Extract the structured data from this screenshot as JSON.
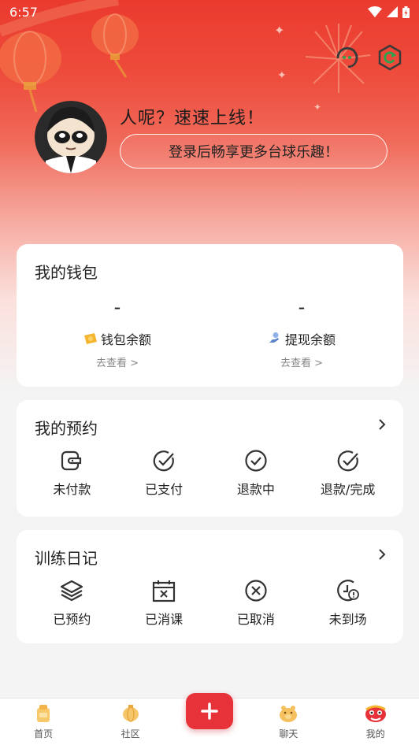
{
  "status_bar": {
    "time": "6:57"
  },
  "profile": {
    "greeting": "人呢？速速上线！",
    "login_button": "登录后畅享更多台球乐趣！"
  },
  "wallet": {
    "title": "我的钱包",
    "balance": {
      "value": "-",
      "label": "钱包余额",
      "link": "去查看 >"
    },
    "withdraw": {
      "value": "-",
      "label": "提现余额",
      "link": "去查看 >"
    }
  },
  "orders": {
    "title": "我的预约",
    "items": [
      {
        "label": "未付款",
        "icon": "wallet-icon"
      },
      {
        "label": "已支付",
        "icon": "check-circle-icon"
      },
      {
        "label": "退款中",
        "icon": "check-circle-icon"
      },
      {
        "label": "退款/完成",
        "icon": "check-circle-icon"
      }
    ]
  },
  "diary": {
    "title": "训练日记",
    "items": [
      {
        "label": "已预约",
        "icon": "layers-icon"
      },
      {
        "label": "已消课",
        "icon": "calendar-x-icon"
      },
      {
        "label": "已取消",
        "icon": "x-circle-icon"
      },
      {
        "label": "未到场",
        "icon": "clock-alert-icon"
      }
    ]
  },
  "tabbar": {
    "tabs": [
      {
        "label": "首页",
        "icon": "home-cup-icon"
      },
      {
        "label": "社区",
        "icon": "community-icon"
      },
      {
        "label": "聊天",
        "icon": "chat-piggy-icon"
      },
      {
        "label": "我的",
        "icon": "lion-dance-icon"
      }
    ],
    "fab_icon": "plus-icon"
  },
  "colors": {
    "accent": "#e8323a",
    "header_top": "#ea3a2e",
    "background": "#f4f4f5"
  }
}
